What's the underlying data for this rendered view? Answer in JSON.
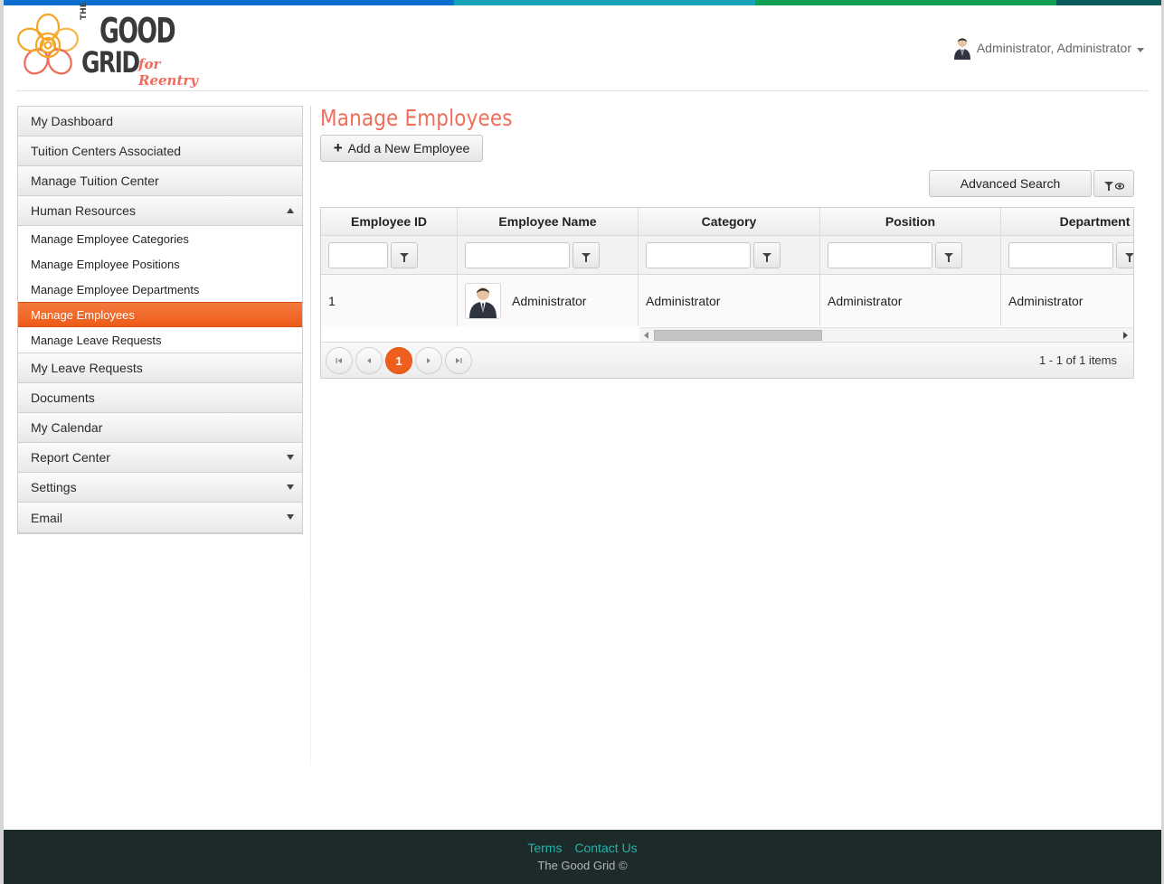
{
  "brand": {
    "logo_the": "THE",
    "logo_good": "GOOD",
    "logo_grid": "GRID",
    "logo_tagline": "for Reentry",
    "colors": {
      "accent": "#ee5f1d",
      "title": "#ef6f5a",
      "footer_link": "#22b4a8",
      "footer_bg": "#1c2a29"
    },
    "top_stripe_colors": [
      "#0a6ed1",
      "#1a8fd8",
      "#17a2b8",
      "#12a05a",
      "#0b5d5d"
    ]
  },
  "header": {
    "user_name": "Administrator, Administrator",
    "user_icon": "user-avatar-icon"
  },
  "sidebar": {
    "items": [
      {
        "label": "My Dashboard",
        "arrow": ""
      },
      {
        "label": "Tuition Centers Associated",
        "arrow": ""
      },
      {
        "label": "Manage Tuition Center",
        "arrow": ""
      },
      {
        "label": "Human Resources",
        "arrow": "up"
      }
    ],
    "sub_items": [
      {
        "label": "Manage Employee Categories",
        "active": false
      },
      {
        "label": "Manage Employee Positions",
        "active": false
      },
      {
        "label": "Manage Employee Departments",
        "active": false
      },
      {
        "label": "Manage Employees",
        "active": true
      },
      {
        "label": "Manage Leave Requests",
        "active": false
      }
    ],
    "items_after": [
      {
        "label": "My Leave Requests",
        "arrow": ""
      },
      {
        "label": "Documents",
        "arrow": ""
      },
      {
        "label": "My Calendar",
        "arrow": ""
      },
      {
        "label": "Report Center",
        "arrow": "down"
      },
      {
        "label": "Settings",
        "arrow": "down"
      },
      {
        "label": "Email",
        "arrow": "down"
      }
    ]
  },
  "main": {
    "title": "Manage Employees",
    "add_button": "Add a New Employee",
    "advanced_search": "Advanced Search"
  },
  "grid": {
    "columns": [
      "Employee ID",
      "Employee Name",
      "Category",
      "Position",
      "Department"
    ],
    "rows": [
      {
        "id": "1",
        "name": "Administrator",
        "category": "Administrator",
        "position": "Administrator",
        "department": "Administrator"
      }
    ],
    "pager": {
      "current_page": "1",
      "info": "1 - 1 of 1 items"
    }
  },
  "footer": {
    "terms": "Terms",
    "contact": "Contact Us",
    "copyright": "The Good Grid ©"
  }
}
